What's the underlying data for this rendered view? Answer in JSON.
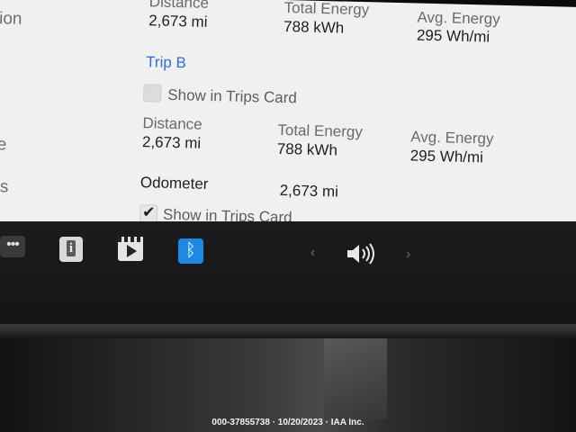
{
  "sidebar": {
    "items": [
      "ation",
      "e",
      "are",
      "des"
    ]
  },
  "trip_a": {
    "distance_label": "Distance",
    "distance_value": "2,673 mi",
    "total_energy_label": "Total Energy",
    "total_energy_value": "788 kWh",
    "avg_energy_label": "Avg. Energy",
    "avg_energy_value": "295 Wh/mi"
  },
  "trip_b": {
    "title": "Trip B",
    "show_in_trips_card_label": "Show in Trips Card",
    "show_in_trips_card_checked": false,
    "distance_label": "Distance",
    "distance_value": "2,673 mi",
    "total_energy_label": "Total Energy",
    "total_energy_value": "788 kWh",
    "avg_energy_label": "Avg. Energy",
    "avg_energy_value": "295 Wh/mi"
  },
  "odometer": {
    "label": "Odometer",
    "value": "2,673 mi",
    "show_in_trips_card_label": "Show in Trips Card",
    "show_in_trips_card_checked": true
  },
  "dock": {
    "icons": [
      "more-icon",
      "manual-icon",
      "theater-icon",
      "bluetooth-icon",
      "previous-icon",
      "volume-icon",
      "next-icon"
    ],
    "more_glyph": "•••",
    "manual_glyph": "i",
    "bluetooth_glyph": "ᛒ",
    "prev_glyph": "‹",
    "next_glyph": "›"
  },
  "watermark": "000-37855738 · 10/20/2023 · IAA Inc.",
  "colors": {
    "screen_bg": "#f0f0f0",
    "accent_blue": "#2f6fd6",
    "dock_bg": "#1c1c1e",
    "bluetooth_bg": "#1e88e5"
  }
}
